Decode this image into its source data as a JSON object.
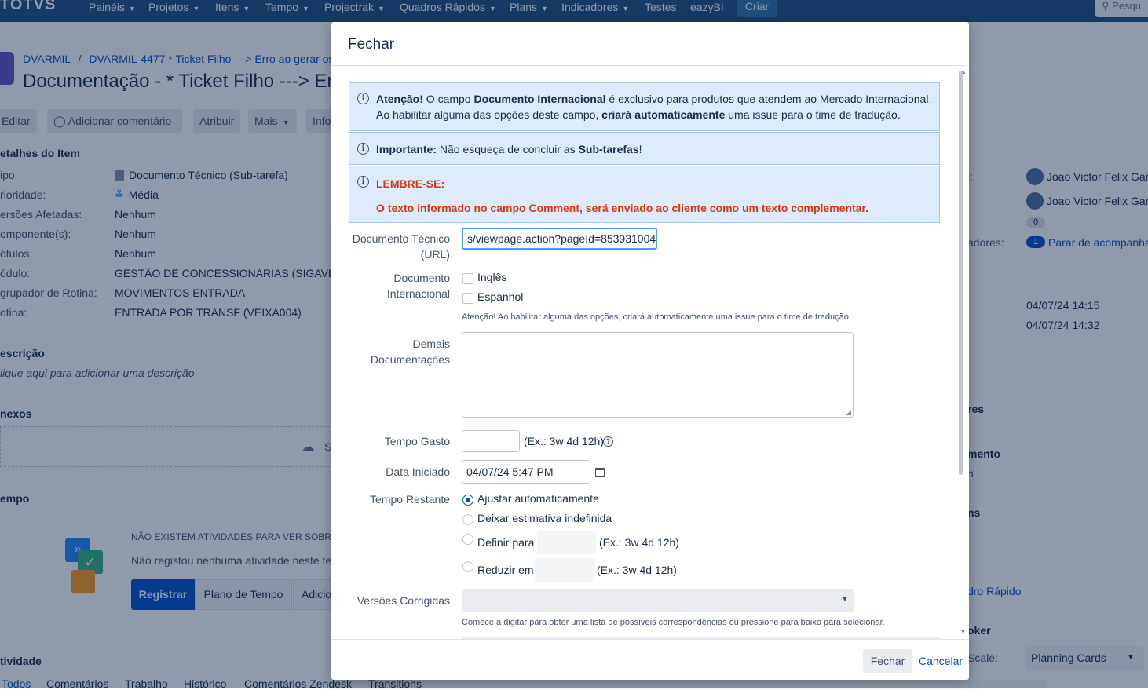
{
  "topnav": {
    "logo": "TOTVS",
    "items": [
      "Painéis",
      "Projetos",
      "Itens",
      "Tempo",
      "Projectrak",
      "Quadros Rápidos",
      "Plans",
      "Indicadores",
      "Testes",
      "eazyBI"
    ],
    "create": "Criar",
    "search_placeholder": "Pesqu"
  },
  "breadcrumb": {
    "project": "DVARMIL",
    "sep": "/",
    "parent": "DVARMIL-4477 * Ticket Filho ---> Erro ao gerar os i"
  },
  "issue_title": "Documentação - * Ticket Filho ---> Er",
  "actions": {
    "edit": "Editar",
    "comment": "Adicionar comentário",
    "assign": "Atribuir",
    "more": "Mais",
    "info": "Info"
  },
  "details": {
    "heading": "etalhes do Item",
    "rows": [
      {
        "label": "ipo:",
        "value": "Documento Técnico (Sub-tarefa)"
      },
      {
        "label": "rioridade:",
        "value": "Média"
      },
      {
        "label": "ersões Afetadas:",
        "value": "Nenhum"
      },
      {
        "label": "omponente(s):",
        "value": "Nenhum"
      },
      {
        "label": "ótulos:",
        "value": "Nenhum"
      },
      {
        "label": "ódulo:",
        "value": "GESTÃO DE CONCESSIONÁRIAS (SIGAVEI)"
      },
      {
        "label": "grupador de Rotina:",
        "value": "MOVIMENTOS ENTRADA"
      },
      {
        "label": "otina:",
        "value": "ENTRADA POR TRANSF (VEIXA004)"
      }
    ]
  },
  "description": {
    "heading": "escrição",
    "placeholder": "lique aqui para adicionar uma descrição"
  },
  "attachments": {
    "heading": "nexos",
    "drop": "S"
  },
  "time": {
    "heading": "empo",
    "empty_title": "NÃO EXISTEM ATIVIDADES PARA VER SOBRE E",
    "empty_text": "Não registou nenhuma atividade neste te",
    "register": "Registrar",
    "plan": "Plano de Tempo",
    "add": "Adicio"
  },
  "activity": {
    "heading": "tividade",
    "tabs": [
      "Todos",
      "Comentários",
      "Trabalho",
      "Histórico",
      "Comentários Zendesk",
      "Transitions"
    ]
  },
  "right": {
    "label1": "l:",
    "person1": "Joao Victor Felix Garc",
    "person2": "Joao Victor Felix Garc",
    "votes": "0",
    "watchers_label": "adores:",
    "watchers_count": "1",
    "watchers_link": "Parar de acompanha",
    "created": "04/07/24 14:15",
    "updated": "04/07/24 14:32",
    "sect1": "res",
    "sect2": "mento",
    "sect2_link": "n",
    "sect3": "ns",
    "quick_link": "dro Rápido",
    "sect4": "oker",
    "scale_label": "Scale:",
    "scale_value": "Planning Cards"
  },
  "dialog": {
    "title": "Fechar",
    "msg1_bold1": "Atenção!",
    "msg1_t1": " O campo ",
    "msg1_bold2": "Documento Internacional",
    "msg1_t2": " é exclusivo para produtos que atendem ao Mercado Internacional.",
    "msg1_line2a": "Ao habilitar alguma das opções deste campo, ",
    "msg1_bold3": "criará automaticamente",
    "msg1_line2b": " uma issue para o time de tradução.",
    "msg2_bold": "Importante:",
    "msg2_t": " Não esqueça de concluir as ",
    "msg2_bold2": "Sub-tarefas",
    "msg2_end": "!",
    "msg3_title": "LEMBRE-SE:",
    "msg3_text": "O texto informado no campo Comment, será enviado ao cliente como um texto complementar.",
    "doc_url_label": "Documento Técnico (URL)",
    "doc_url_value": "s/viewpage.action?pageId=853931004",
    "intl_label": "Documento Internacional",
    "intl_opt1": "Inglês",
    "intl_opt2": "Espanhol",
    "intl_help": "Atenção! Ao habilitar alguma das opções, criará automaticamente uma issue para o time de tradução.",
    "other_docs_label": "Demais Documentações",
    "time_spent_label": "Tempo Gasto",
    "time_hint": "(Ex.: 3w 4d 12h)",
    "date_label": "Data Iniciado",
    "date_value": "04/07/24 5:47 PM",
    "remaining_label": "Tempo Restante",
    "rem_opt1": "Ajustar automaticamente",
    "rem_opt2": "Deixar estimativa indefinida",
    "rem_opt3": "Definir para",
    "rem_opt4": "Reduzir em",
    "rem_hint": "(Ex.: 3w 4d 12h)",
    "fix_versions_label": "Versões Corrigidas",
    "fix_versions_help": "Comece a digitar para obter uma lista de possíveis correspondências ou pressione para baixo para selecionar.",
    "submit": "Fechar",
    "cancel": "Cancelar"
  }
}
